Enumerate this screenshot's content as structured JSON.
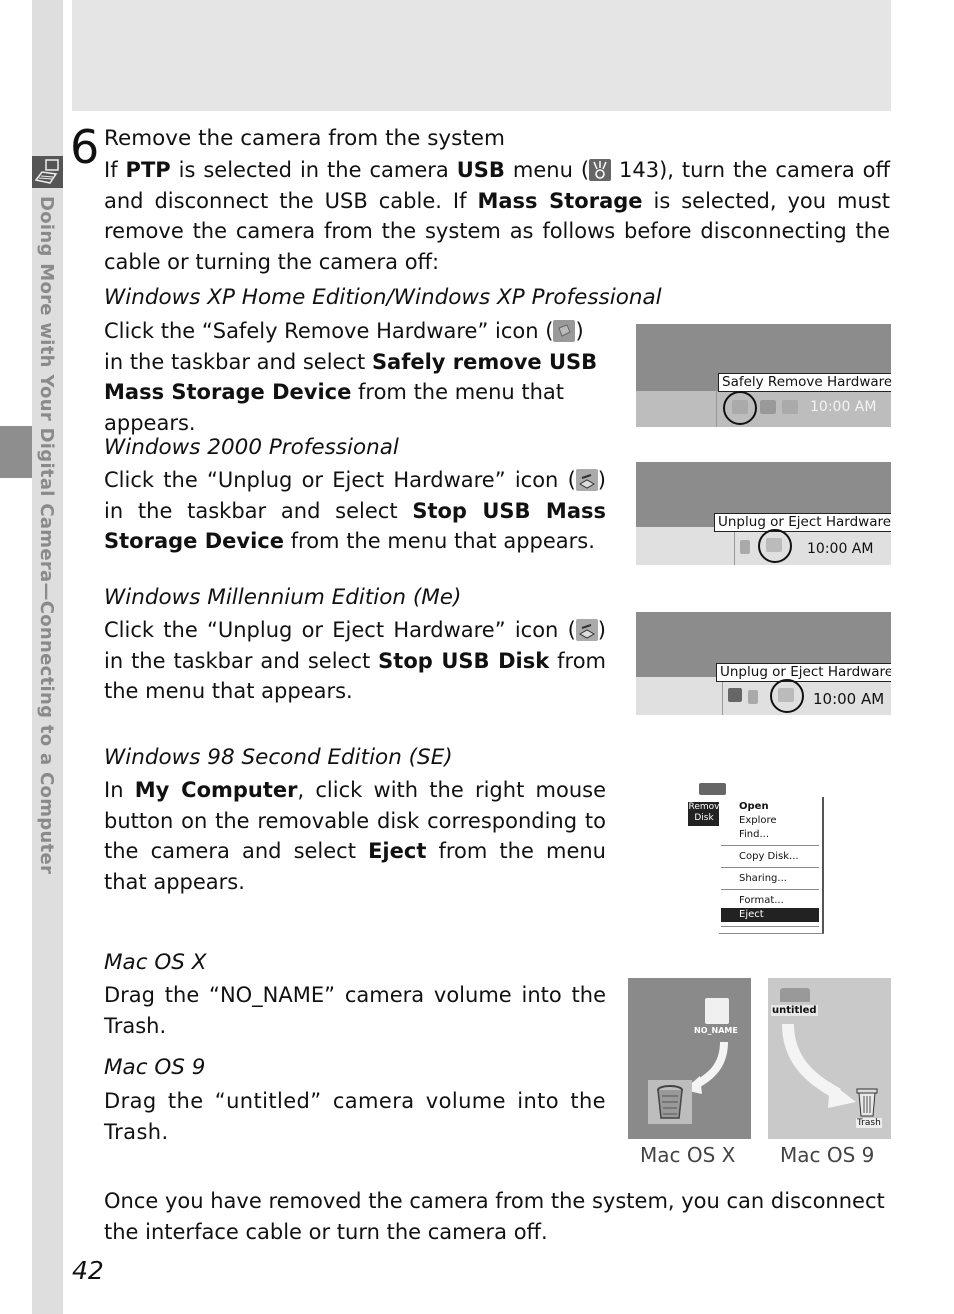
{
  "sidebar": {
    "section_title": "Doing More with Your Digital Camera—Connecting to a Computer",
    "section_icon": "computer-connection-icon"
  },
  "step": {
    "number": "6",
    "title": "Remove the camera from the system",
    "intro": {
      "t1": "If ",
      "b1": "PTP",
      "t2": " is selected in the camera ",
      "b2": "USB",
      "t3": " menu (",
      "ref_icon": "menu-reference-icon",
      "ref_page": " 143), turn the camera off and disconnect the USB cable.  If ",
      "b3": "Mass Storage",
      "t4": " is selected, you must remove the camera from the system as follows before disconnecting the cable or turning the camera off:"
    }
  },
  "sections": {
    "winxp": {
      "heading": "Windows XP Home Edition/Windows XP Professional",
      "t1": "Click the “Safely Remove Hardware” icon (",
      "icon": "safely-remove-hardware-icon",
      "t2": ") in the taskbar and select ",
      "b1": "Safely remove USB Mass Storage Device",
      "t3": " from the menu that appears.",
      "screenshot": {
        "tooltip": "Safely Remove Hardware",
        "clock": "10:00 AM"
      }
    },
    "win2000": {
      "heading": "Windows 2000 Professional",
      "t1": "Click the “Unplug or Eject Hardware” icon (",
      "icon": "unplug-eject-hardware-icon",
      "t2": ") in the taskbar and select ",
      "b1": "Stop USB Mass Storage Device",
      "t3": " from the menu that appears.",
      "screenshot": {
        "tooltip": "Unplug or Eject Hardware",
        "clock": "10:00 AM"
      }
    },
    "winme": {
      "heading": "Windows Millennium Edition (Me)",
      "t1": "Click the “Unplug or Eject Hardware” icon (",
      "icon": "unplug-eject-hardware-icon",
      "t2": ") in the taskbar and select ",
      "b1": "Stop USB Disk",
      "t3": " from the menu that appears.",
      "screenshot": {
        "tooltip": "Unplug or Eject Hardware",
        "clock": "10:00 AM"
      }
    },
    "win98": {
      "heading": "Windows 98 Second Edition (SE)",
      "t1": "In ",
      "b1": "My Computer",
      "t2": ", click with the right mouse button on the removable disk corresponding to the camera and select ",
      "b2": "Eject",
      "t3": " from the menu that appears.",
      "screenshot": {
        "disk_label_1": "Remov",
        "disk_label_2": "Disk",
        "menu_items": [
          "Open",
          "Explore",
          "Find...",
          "Copy Disk...",
          "Sharing...",
          "Format...",
          "Eject"
        ],
        "selected_item": "Eject"
      }
    },
    "macosx": {
      "heading": "Mac OS X",
      "text": "Drag the “NO_NAME” camera volume into the Trash.",
      "screenshot": {
        "volume_label": "NO_NAME",
        "caption": "Mac OS X"
      }
    },
    "macos9": {
      "heading": "Mac OS 9",
      "text": "Drag the “untitled” camera volume into the Trash.",
      "screenshot": {
        "volume_label": "untitled",
        "trash_label": "Trash",
        "caption": "Mac OS 9"
      }
    }
  },
  "closing": "Once you have removed the camera from the system, you can disconnect the interface cable or turn the camera off.",
  "page_number": "42"
}
